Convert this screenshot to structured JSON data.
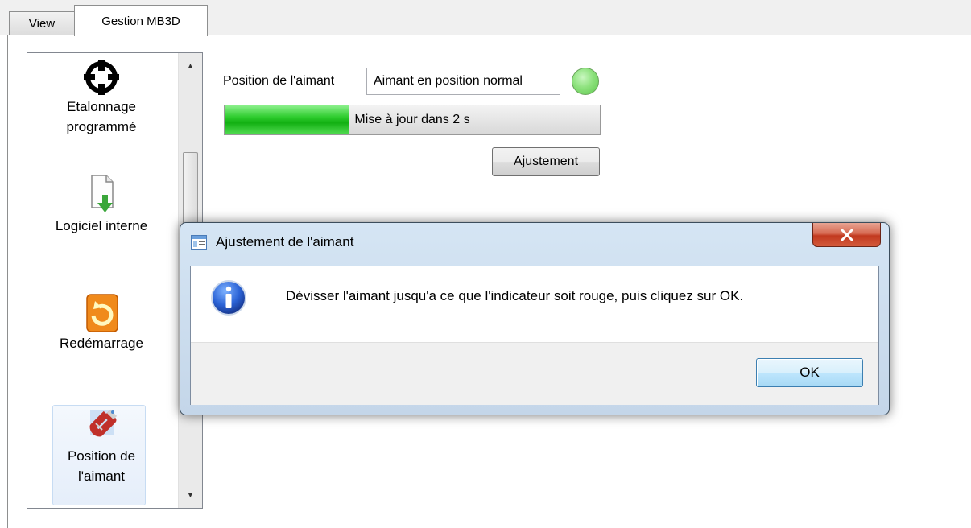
{
  "tabs": [
    {
      "label": "View",
      "active": false
    },
    {
      "label": "Gestion MB3D",
      "active": true
    }
  ],
  "sidebar": {
    "items": [
      {
        "label_line1": "Etalonnage",
        "label_line2": "programmé",
        "icon": "crosshair-icon"
      },
      {
        "label_line1": "Logiciel interne",
        "label_line2": "",
        "icon": "firmware-download-icon"
      },
      {
        "label_line1": "Redémarrage",
        "label_line2": "",
        "icon": "restart-icon"
      },
      {
        "label_line1": "Position de",
        "label_line2": "l'aimant",
        "icon": "magnet-icon",
        "selected": true
      }
    ]
  },
  "main": {
    "position_label": "Position de l'aimant",
    "position_value": "Aimant en position normal",
    "indicator_color": "#7ed86c",
    "progress": {
      "value_fraction": 0.33,
      "text": "Mise à jour dans 2 s"
    },
    "adjust_button": "Ajustement"
  },
  "dialog": {
    "title": "Ajustement de l'aimant",
    "message": "Dévisser l'aimant jusqu'a ce que l'indicateur soit rouge, puis cliquez sur OK.",
    "ok_button": "OK",
    "icon": "info-icon"
  }
}
